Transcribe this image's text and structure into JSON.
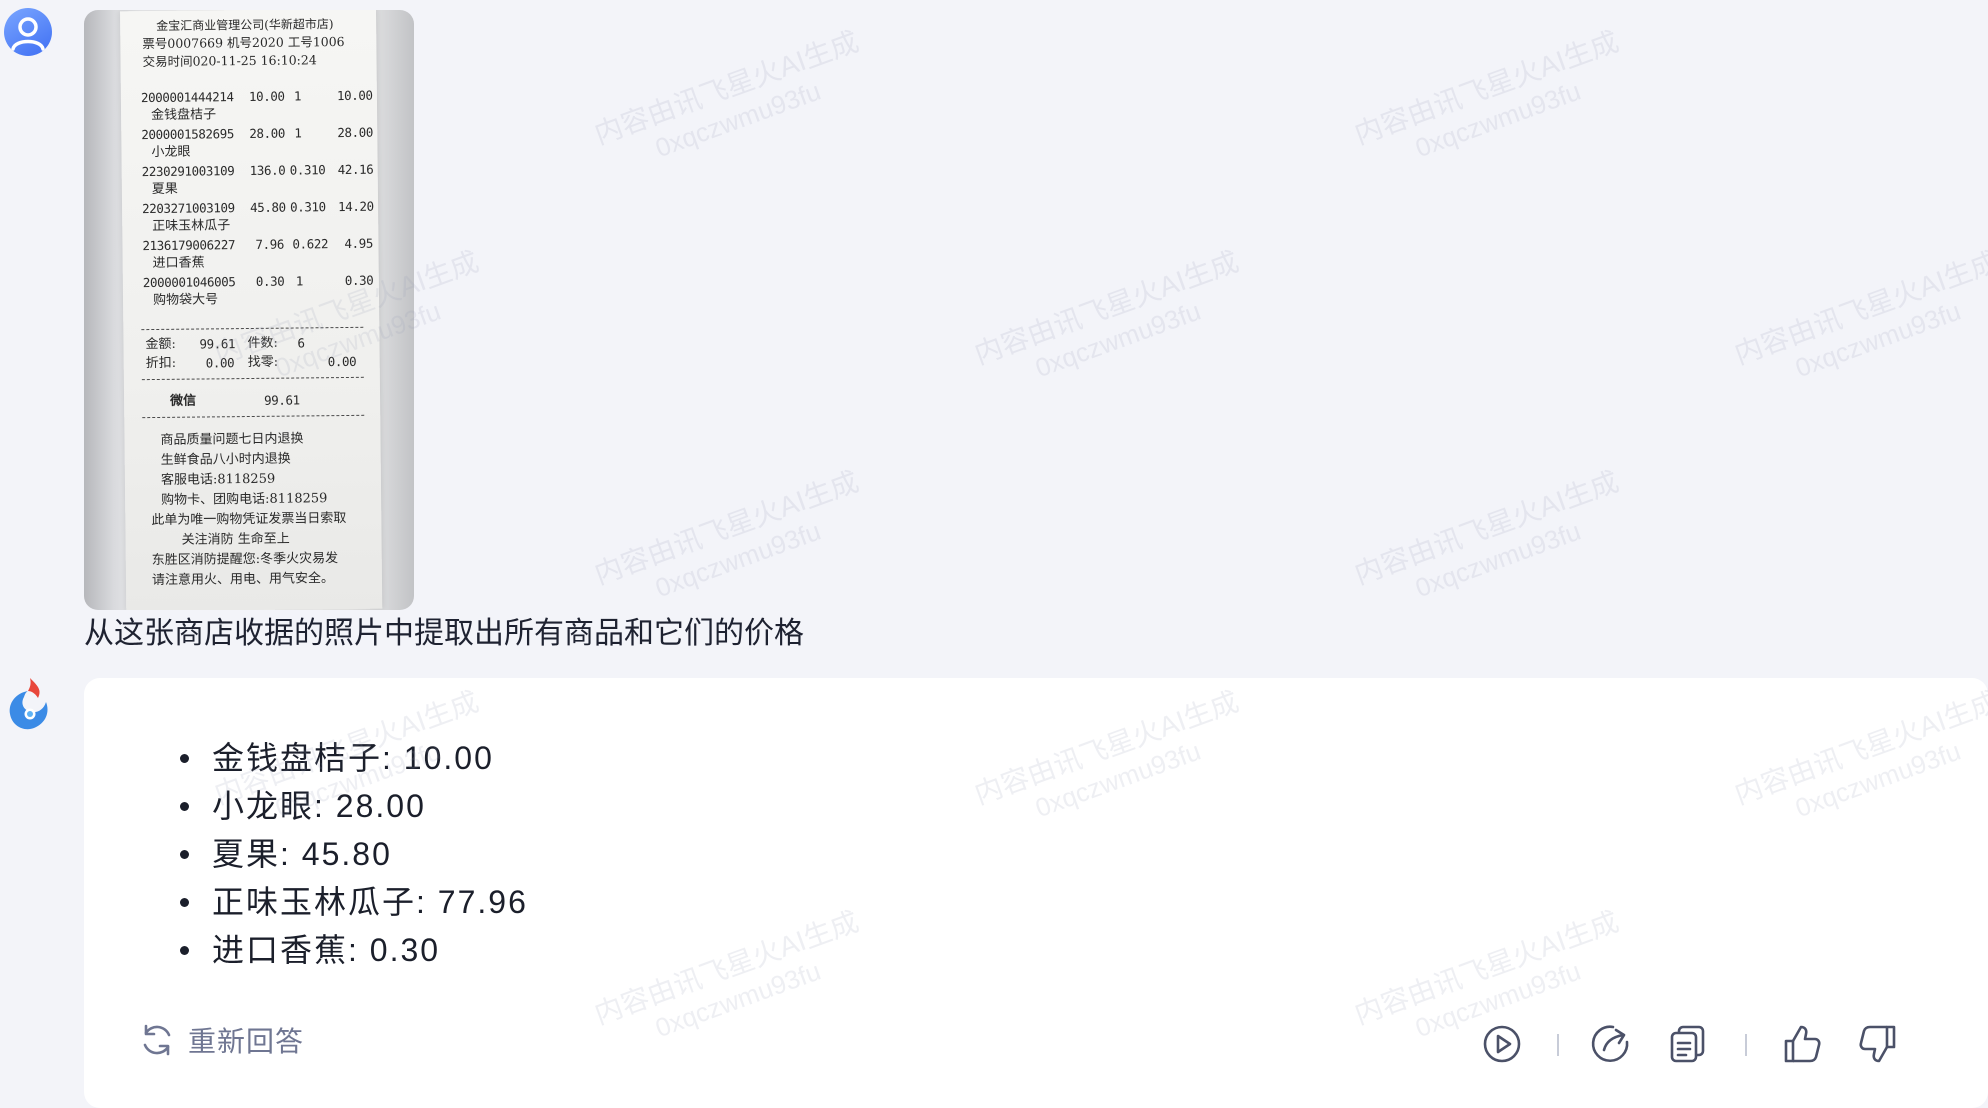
{
  "user": {
    "avatar_icon": "user-avatar-icon",
    "question": "从这张商店收据的照片中提取出所有商品和它们的价格"
  },
  "receipt": {
    "header": [
      "金宝汇商业管理公司(华新超市店)",
      "票号0007669 机号2020 工号1006",
      "交易时间020-11-25 16:10:24"
    ],
    "items": [
      {
        "code": "2000001444214",
        "price": "10.00",
        "qty": "1",
        "amount": "10.00",
        "name": "金钱盘桔子"
      },
      {
        "code": "2000001582695",
        "price": "28.00",
        "qty": "1",
        "amount": "28.00",
        "name": "小龙眼"
      },
      {
        "code": "2230291003109",
        "price": "136.0",
        "qty": "0.310",
        "amount": "42.16",
        "name": "夏果"
      },
      {
        "code": "2203271003109",
        "price": "45.80",
        "qty": "0.310",
        "amount": "14.20",
        "name": "正味玉林瓜子"
      },
      {
        "code": "2136179006227",
        "price": "7.96",
        "qty": "0.622",
        "amount": "4.95",
        "name": "进口香蕉"
      },
      {
        "code": "2000001046005",
        "price": "0.30",
        "qty": "1",
        "amount": "0.30",
        "name": "购物袋大号"
      }
    ],
    "totals": [
      {
        "left": "金额:",
        "leftval": "99.61",
        "right": "件数:",
        "rightval": "6"
      },
      {
        "left": "折扣:",
        "leftval": "0.00",
        "right": "找零:",
        "rightval": "0.00"
      }
    ],
    "payment": {
      "method": "微信",
      "amount": "99.61"
    },
    "footer": [
      "商品质量问题七日内退换",
      "生鲜食品八小时内退换",
      "客服电话:8118259",
      "购物卡、团购电话:8118259",
      "此单为唯一购物凭证发票当日索取",
      "关注消防    生命至上",
      "东胜区消防提醒您:冬季火灾易发",
      "请注意用火、用电、用气安全。"
    ]
  },
  "assistant": {
    "avatar_icon": "xinghuo-logo-icon",
    "answer_items": [
      "金钱盘桔子: 10.00",
      "小龙眼: 28.00",
      "夏果: 45.80",
      "正味玉林瓜子: 77.96",
      "进口香蕉: 0.30"
    ],
    "regenerate_label": "重新回答",
    "toolbar_icons": [
      "play-audio-icon",
      "share-icon",
      "copy-icon",
      "thumbs-up-icon",
      "thumbs-down-icon"
    ]
  },
  "watermark": {
    "line1": "内容由讯飞星火AI生成",
    "line2": "0xqczwmu93fu"
  },
  "colors": {
    "page_bg": "#f3f4f9",
    "card_bg": "#ffffff",
    "text": "#1b1f2b",
    "muted": "#6f7692",
    "accent": "#3f6ff3"
  }
}
